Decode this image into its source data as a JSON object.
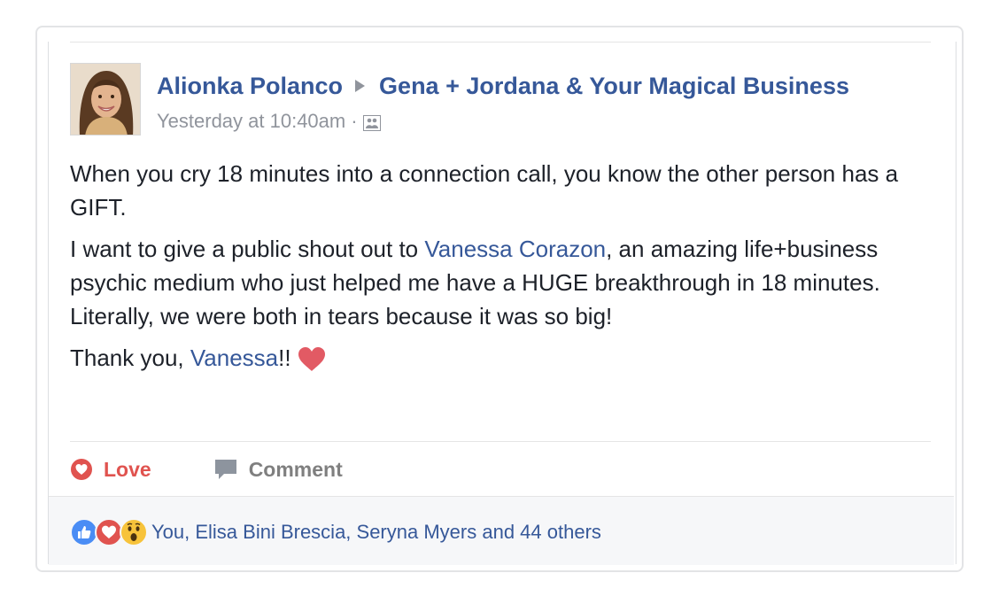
{
  "post": {
    "author": "Alionka Polanco",
    "group": "Gena + Jordana & Your Magical Business",
    "timestamp": "Yesterday at 10:40am",
    "separator": "·",
    "audience_icon": "group-audience-icon",
    "paragraph1": "When you cry 18 minutes into a connection call, you know the other person has a GIFT.",
    "paragraph2_before": "I want to give a public shout out to ",
    "paragraph2_link": "Vanessa Corazon",
    "paragraph2_after": ", an amazing life+business psychic medium who just helped me have a HUGE breakthrough in 18 minutes. Literally, we were both in tears because it was so big!",
    "paragraph3_before": "Thank you, ",
    "paragraph3_link": "Vanessa",
    "paragraph3_after": "!!",
    "paragraph3_emoji": "red-heart-emoji"
  },
  "actions": {
    "love_label": "Love",
    "comment_label": "Comment"
  },
  "reactions": {
    "icons": [
      "like-reaction-icon",
      "love-reaction-icon",
      "wow-reaction-icon"
    ],
    "summary": "You, Elisa Bini Brescia, Seryna Myers and 44 others"
  },
  "colors": {
    "link": "#365899",
    "love": "#e0534f",
    "muted": "#90949c",
    "text": "#1d2129"
  }
}
